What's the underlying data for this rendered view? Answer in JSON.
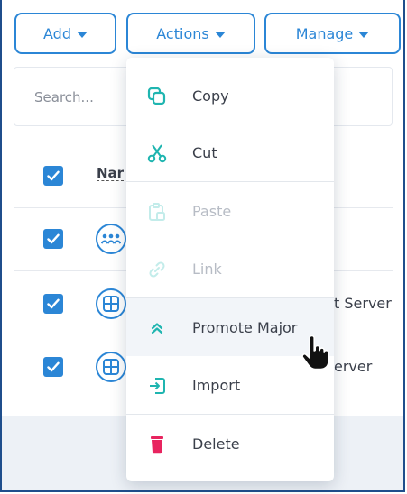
{
  "toolbar": {
    "add_label": "Add",
    "actions_label": "Actions",
    "manage_label": "Manage"
  },
  "search": {
    "placeholder": "Search..."
  },
  "table": {
    "header_name": "Nar",
    "rows": [
      {
        "checked": true,
        "icon": "group-icon",
        "text": ""
      },
      {
        "checked": true,
        "icon": "windows-icon",
        "text": "t Server"
      },
      {
        "checked": true,
        "icon": "windows-icon",
        "text": "erver"
      }
    ]
  },
  "actions_menu": {
    "items": [
      {
        "label": "Copy",
        "icon": "copy-icon",
        "enabled": true
      },
      {
        "label": "Cut",
        "icon": "scissors-icon",
        "enabled": true
      },
      {
        "label": "Paste",
        "icon": "clipboard-icon",
        "enabled": false
      },
      {
        "label": "Link",
        "icon": "link-icon",
        "enabled": false
      },
      {
        "label": "Promote Major",
        "icon": "double-chevron-up-icon",
        "enabled": true,
        "hovered": true
      },
      {
        "label": "Import",
        "icon": "import-icon",
        "enabled": true
      },
      {
        "label": "Delete",
        "icon": "trash-icon",
        "enabled": true
      }
    ]
  },
  "colors": {
    "primary": "#2b86d6",
    "teal_icon": "#1fb5b0",
    "delete_icon": "#e8245f",
    "disabled_icon": "#c3ecea",
    "frame_border": "#1f4e8c"
  }
}
